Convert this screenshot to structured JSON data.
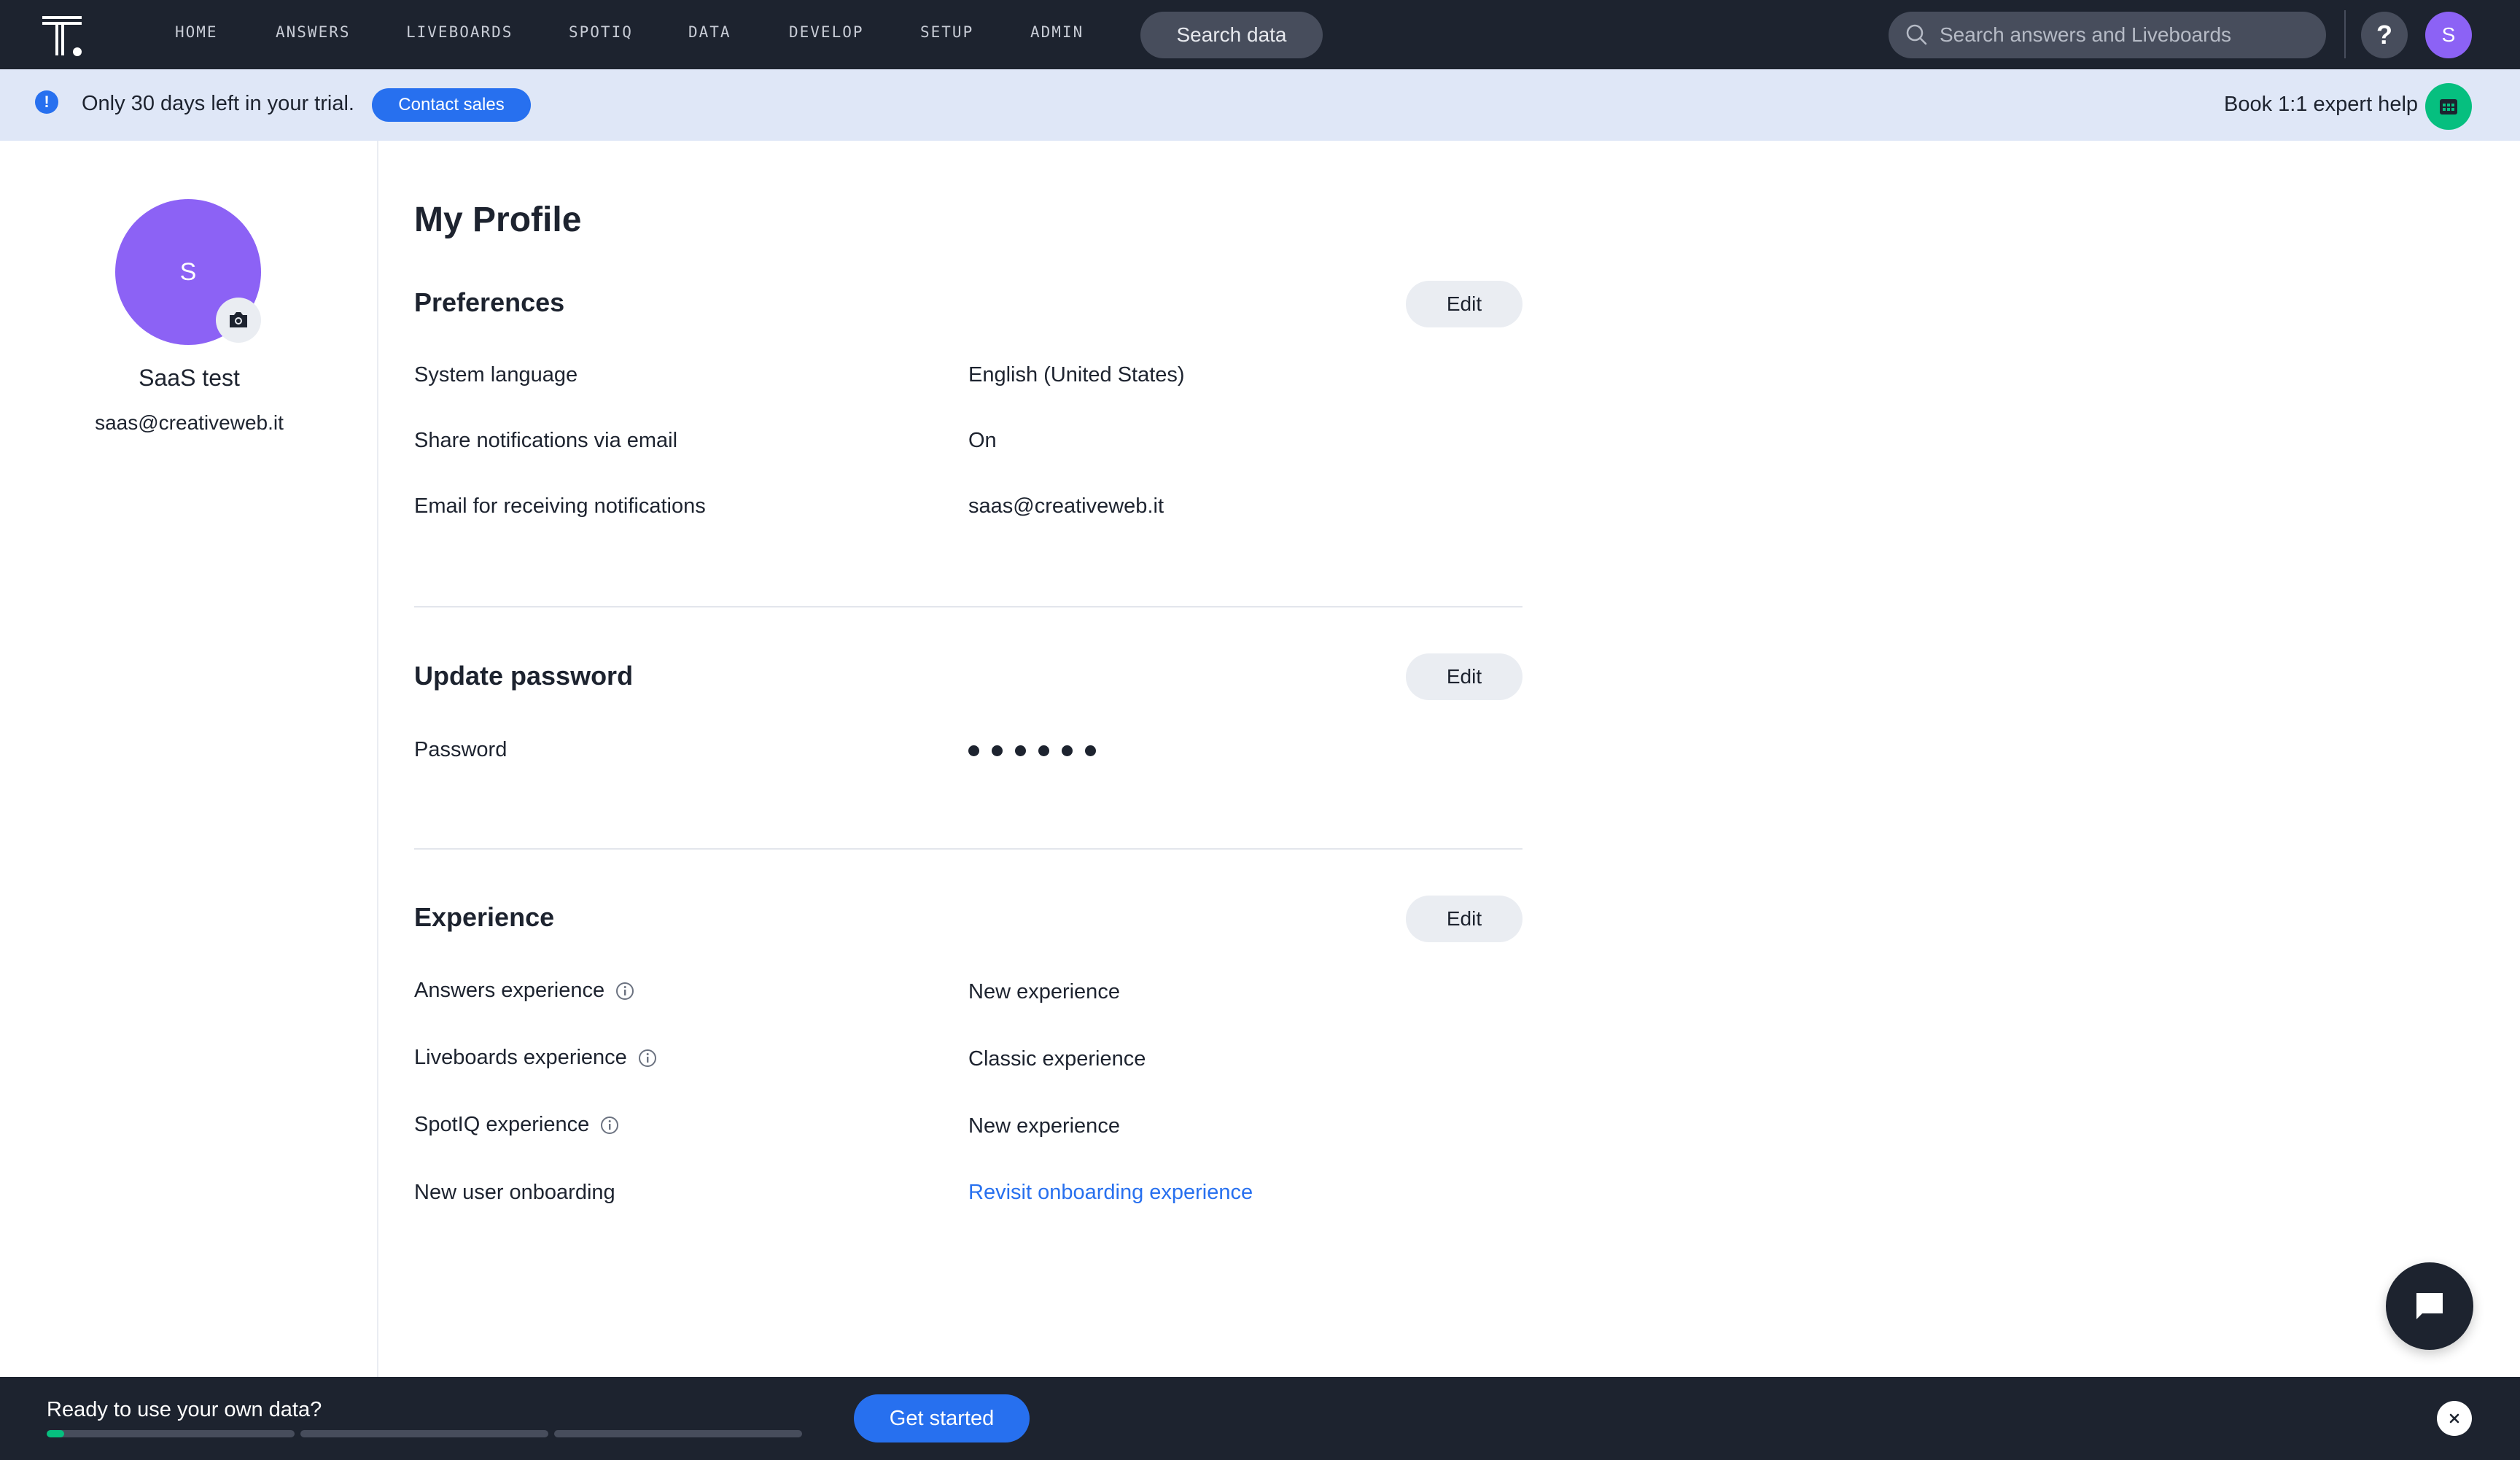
{
  "nav": {
    "items": [
      {
        "label": "HOME",
        "name": "nav-home"
      },
      {
        "label": "ANSWERS",
        "name": "nav-answers"
      },
      {
        "label": "LIVEBOARDS",
        "name": "nav-liveboards"
      },
      {
        "label": "SPOTIQ",
        "name": "nav-spotiq"
      },
      {
        "label": "DATA",
        "name": "nav-data"
      },
      {
        "label": "DEVELOP",
        "name": "nav-develop"
      },
      {
        "label": "SETUP",
        "name": "nav-setup"
      },
      {
        "label": "ADMIN",
        "name": "nav-admin"
      }
    ],
    "search_data_label": "Search data",
    "search_placeholder": "Search answers and Liveboards",
    "help_label": "?",
    "avatar_initial": "S"
  },
  "banner": {
    "trial_text": "Only 30 days left in your trial.",
    "contact_label": "Contact sales",
    "book_help_label": "Book 1:1 expert help"
  },
  "profile": {
    "avatar_initial": "S",
    "name": "SaaS test",
    "email": "saas@creativeweb.it"
  },
  "page": {
    "title": "My Profile",
    "edit_label": "Edit"
  },
  "preferences": {
    "title": "Preferences",
    "rows": [
      {
        "label": "System language",
        "value": "English (United States)"
      },
      {
        "label": "Share notifications via email",
        "value": "On"
      },
      {
        "label": "Email for receiving notifications",
        "value": "saas@creativeweb.it"
      }
    ]
  },
  "password": {
    "title": "Update password",
    "label": "Password",
    "masked_length": 6
  },
  "experience": {
    "title": "Experience",
    "rows": [
      {
        "label": "Answers experience",
        "value": "New experience"
      },
      {
        "label": "Liveboards experience",
        "value": "Classic experience"
      },
      {
        "label": "SpotIQ experience",
        "value": "New experience"
      },
      {
        "label": "New user onboarding",
        "value": "Revisit onboarding experience"
      }
    ]
  },
  "onboarding": {
    "ready_text": "Ready to use your own data?",
    "get_started_label": "Get started",
    "progress": [
      0.07,
      0,
      0
    ]
  },
  "colors": {
    "nav_bg": "#1d232f",
    "accent": "#2770ef",
    "avatar": "#8c62f5",
    "success": "#06bf7f",
    "banner_bg": "#dfe7f7"
  }
}
